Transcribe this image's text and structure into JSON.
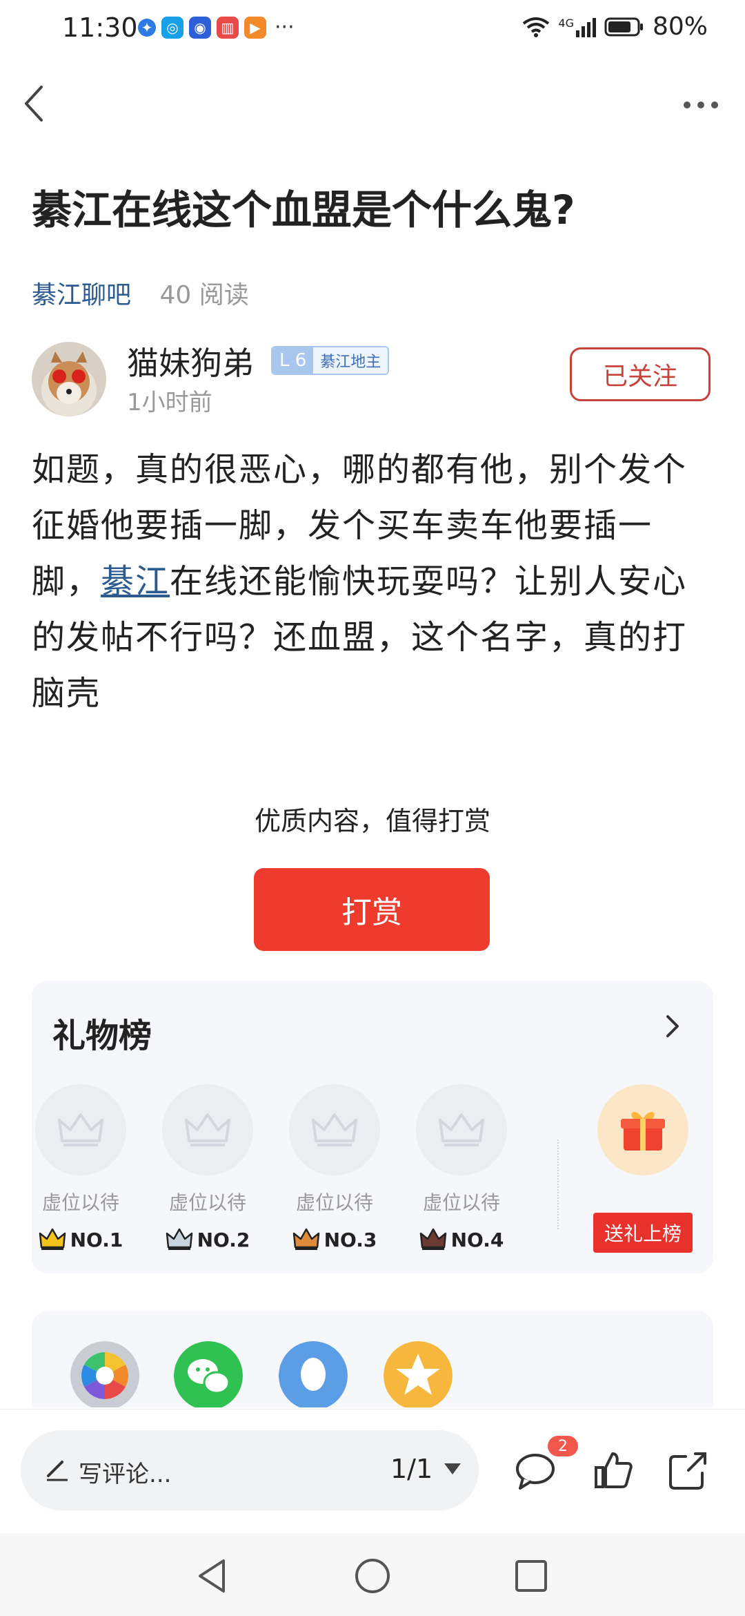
{
  "status_bar": {
    "time": "11:30",
    "more": "···",
    "network": "4G",
    "battery": "80%"
  },
  "post": {
    "title": "綦江在线这个血盟是个什么鬼?",
    "forum": "綦江聊吧",
    "reads": "40 阅读",
    "author": {
      "name": "猫妹狗弟",
      "level": "L 6",
      "rank": "綦江地主",
      "time": "1小时前",
      "follow_label": "已关注"
    },
    "body_before_link": "如题，真的很恶心，哪的都有他，别个发个征婚他要插一脚，发个买车卖车他要插一脚，",
    "body_link": "綦江",
    "body_after_link": "在线还能愉快玩耍吗？让别人安心的发帖不行吗？还血盟，这个名字，真的打脑壳"
  },
  "reward": {
    "prompt": "优质内容，值得打赏",
    "button_label": "打赏"
  },
  "gift_board": {
    "title": "礼物榜",
    "slots": [
      {
        "label": "虚位以待",
        "rank": "NO.1",
        "crown_color": "#f3c21b"
      },
      {
        "label": "虚位以待",
        "rank": "NO.2",
        "crown_color": "#c9d3dd"
      },
      {
        "label": "虚位以待",
        "rank": "NO.3",
        "crown_color": "#e08a3c"
      },
      {
        "label": "虚位以待",
        "rank": "NO.4",
        "crown_color": "#6b3b33"
      }
    ],
    "send_label": "送礼上榜"
  },
  "share": {
    "items": [
      "camera-share-icon",
      "wechat-icon",
      "qq-icon",
      "qzone-icon"
    ]
  },
  "bottom_bar": {
    "comment_placeholder": "写评论...",
    "page_indicator": "1/1",
    "comment_count": "2"
  },
  "colors": {
    "accent_red": "#ef3b2d",
    "link_blue": "#2b5b92"
  }
}
